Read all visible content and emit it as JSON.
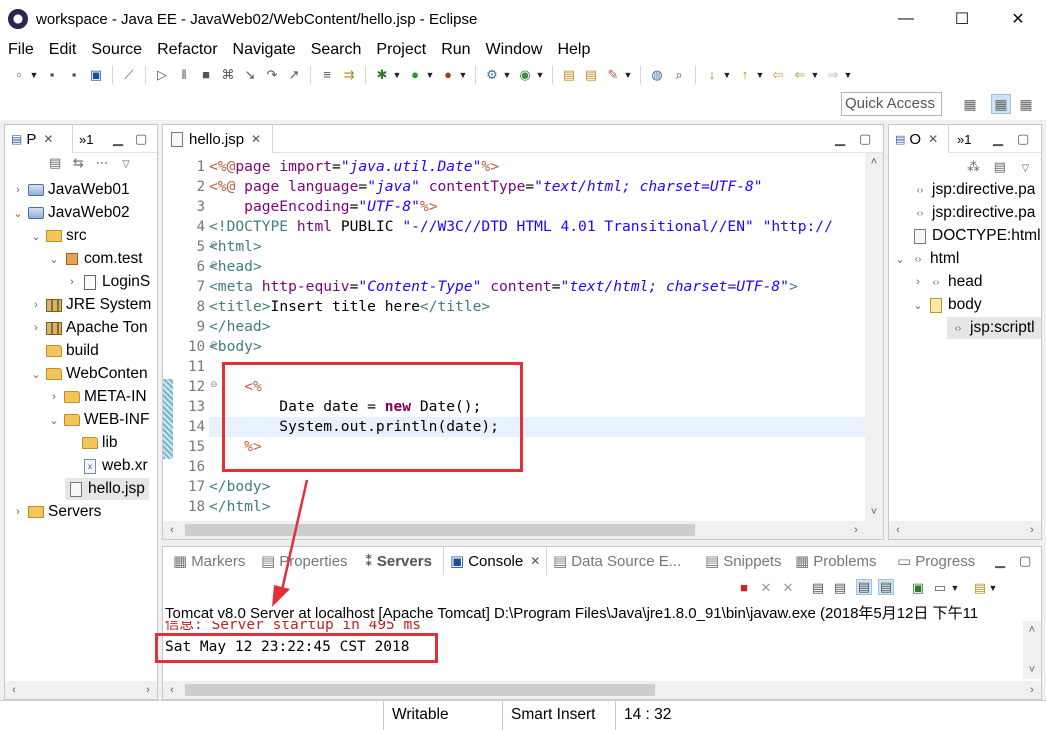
{
  "window": {
    "title": "workspace - Java EE - JavaWeb02/WebContent/hello.jsp - Eclipse",
    "minimize": "—",
    "maximize": "☐",
    "close": "✕"
  },
  "menu": [
    "File",
    "Edit",
    "Source",
    "Refactor",
    "Navigate",
    "Search",
    "Project",
    "Run",
    "Window",
    "Help"
  ],
  "quick_access": {
    "placeholder": "Quick Access"
  },
  "explorer": {
    "tab_label": "P",
    "tab_overflow": "»1",
    "items": [
      {
        "label": "JavaWeb01"
      },
      {
        "label": "JavaWeb02"
      },
      {
        "label": "src"
      },
      {
        "label": "com.test"
      },
      {
        "label": "LoginS"
      },
      {
        "label": "JRE System"
      },
      {
        "label": "Apache Ton"
      },
      {
        "label": "build"
      },
      {
        "label": "WebConten"
      },
      {
        "label": "META-IN"
      },
      {
        "label": "WEB-INF"
      },
      {
        "label": "lib"
      },
      {
        "label": "web.xr"
      },
      {
        "label": "hello.jsp"
      },
      {
        "label": "Servers"
      }
    ]
  },
  "editor": {
    "tab_label": "hello.jsp",
    "line_numbers": [
      "1",
      "2",
      "3",
      "4",
      "5",
      "6",
      "7",
      "8",
      "9",
      "10",
      "11",
      "12",
      "13",
      "14",
      "15",
      "16",
      "17",
      "18"
    ],
    "lines": [
      [
        [
          "dlm",
          "<%@"
        ],
        [
          "dir",
          "page "
        ],
        [
          "at",
          "import"
        ],
        [
          "plain",
          "="
        ],
        [
          "av",
          "\"java.util.Date\""
        ],
        [
          "dlm",
          "%>"
        ]
      ],
      [
        [
          "dlm",
          "<%@ "
        ],
        [
          "dir",
          "page "
        ],
        [
          "at",
          "language"
        ],
        [
          "plain",
          "="
        ],
        [
          "av",
          "\"java\""
        ],
        [
          "plain",
          " "
        ],
        [
          "at",
          "contentType"
        ],
        [
          "plain",
          "="
        ],
        [
          "av",
          "\"text/html; charset=UTF-8\""
        ]
      ],
      [
        [
          "plain",
          "    "
        ],
        [
          "at",
          "pageEncoding"
        ],
        [
          "plain",
          "="
        ],
        [
          "av",
          "\"UTF-8\""
        ],
        [
          "dlm",
          "%>"
        ]
      ],
      [
        [
          "tg",
          "<!"
        ],
        [
          "tagn",
          "DOCTYPE "
        ],
        [
          "at",
          "html "
        ],
        [
          "plain",
          "PUBLIC "
        ],
        [
          "av2",
          "\"-//W3C//DTD HTML 4.01 Transitional//EN\""
        ],
        [
          "plain",
          " "
        ],
        [
          "av2",
          "\"http://"
        ]
      ],
      [
        [
          "tg",
          "<"
        ],
        [
          "tagn",
          "html"
        ],
        [
          "tg",
          ">"
        ]
      ],
      [
        [
          "tg",
          "<"
        ],
        [
          "tagn",
          "head"
        ],
        [
          "tg",
          ">"
        ]
      ],
      [
        [
          "tg",
          "<"
        ],
        [
          "tagn",
          "meta "
        ],
        [
          "at",
          "http-equiv"
        ],
        [
          "plain",
          "="
        ],
        [
          "av",
          "\"Content-Type\""
        ],
        [
          "plain",
          " "
        ],
        [
          "at",
          "content"
        ],
        [
          "plain",
          "="
        ],
        [
          "av",
          "\"text/html; charset=UTF-8\""
        ],
        [
          "tg",
          ">"
        ]
      ],
      [
        [
          "tg",
          "<"
        ],
        [
          "tagn",
          "title"
        ],
        [
          "tg",
          ">"
        ],
        [
          "plain",
          "Insert title here"
        ],
        [
          "tg",
          "</"
        ],
        [
          "tagn",
          "title"
        ],
        [
          "tg",
          ">"
        ]
      ],
      [
        [
          "tg",
          "</"
        ],
        [
          "tagn",
          "head"
        ],
        [
          "tg",
          ">"
        ]
      ],
      [
        [
          "tg",
          "<"
        ],
        [
          "tagn",
          "body"
        ],
        [
          "tg",
          ">"
        ]
      ],
      [],
      [
        [
          "plain",
          "    "
        ],
        [
          "dlm",
          "<%"
        ]
      ],
      [
        [
          "plain",
          "        Date date = "
        ],
        [
          "kw",
          "new"
        ],
        [
          "plain",
          " Date();"
        ]
      ],
      [
        [
          "plain",
          "        System.out.println(date);"
        ]
      ],
      [
        [
          "plain",
          "    "
        ],
        [
          "dlm",
          "%>"
        ]
      ],
      [],
      [
        [
          "tg",
          "</"
        ],
        [
          "tagn",
          "body"
        ],
        [
          "tg",
          ">"
        ]
      ],
      [
        [
          "tg",
          "</"
        ],
        [
          "tagn",
          "html"
        ],
        [
          "tg",
          ">"
        ]
      ]
    ]
  },
  "outline": {
    "tab_label": "O",
    "tab_overflow": "»1",
    "items": [
      {
        "label": "jsp:directive.pa"
      },
      {
        "label": "jsp:directive.pa"
      },
      {
        "label": "DOCTYPE:html"
      },
      {
        "label": "html"
      },
      {
        "label": "head"
      },
      {
        "label": "body"
      },
      {
        "label": "jsp:scriptl"
      }
    ]
  },
  "bottom_tabs": [
    "Markers",
    "Properties",
    "Servers",
    "Console",
    "Data Source E...",
    "Snippets",
    "Problems",
    "Progress"
  ],
  "console": {
    "description": "Tomcat v8.0 Server at localhost [Apache Tomcat] D:\\Program Files\\Java\\jre1.8.0_91\\bin\\javaw.exe (2018年5月12日 下午11",
    "info_line": "信息: Server startup in 495 ms",
    "output_line": "Sat May 12 23:22:45 CST 2018"
  },
  "status": {
    "writable": "Writable",
    "insert_mode": "Smart Insert",
    "position": "14 : 32"
  },
  "colors": {
    "annotation_red": "#e0303a",
    "current_line": "#e8f2fe",
    "console_info": "#c02020"
  }
}
